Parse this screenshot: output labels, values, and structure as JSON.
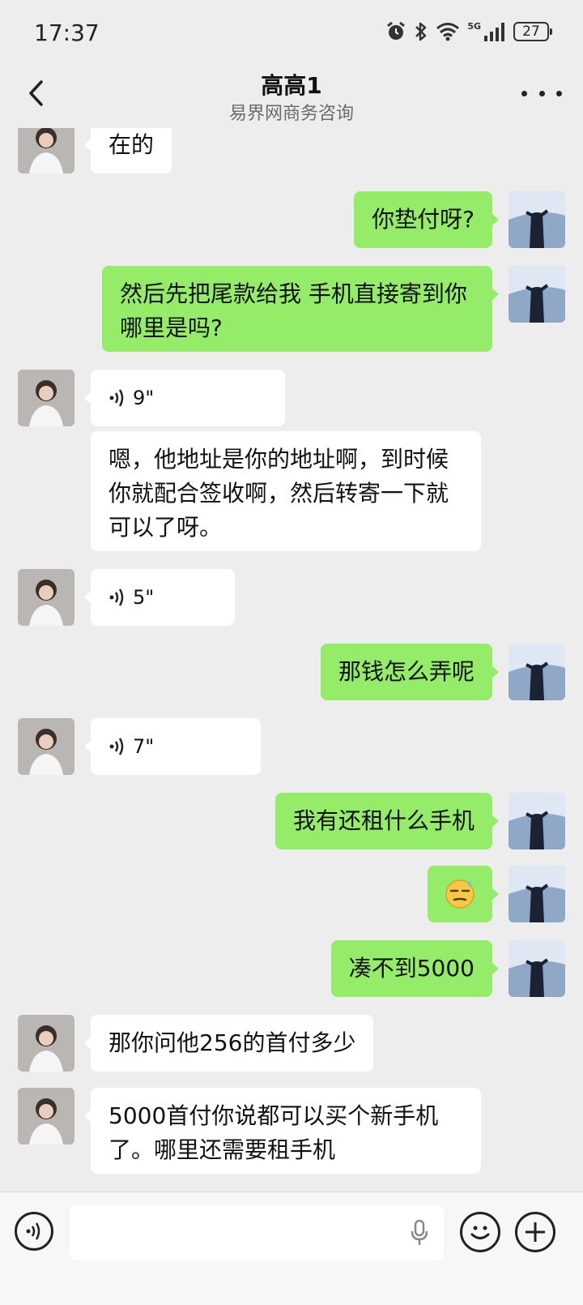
{
  "status_bar": {
    "time": "17:37",
    "network": "5G",
    "battery": "27",
    "icons": [
      "alarm-icon",
      "bluetooth-icon",
      "wifi-icon",
      "signal-icon",
      "battery-icon"
    ]
  },
  "header": {
    "title": "高高1",
    "subtitle": "易界网商务咨询",
    "back_icon": "chevron-left-icon",
    "more_icon": "more-dots-icon"
  },
  "messages": [
    {
      "from": "other",
      "type": "text",
      "text": "在的"
    },
    {
      "from": "me",
      "type": "text",
      "text": "你垫付呀?"
    },
    {
      "from": "me",
      "type": "text",
      "text": "然后先把尾款给我 手机直接寄到你哪里是吗?"
    },
    {
      "from": "other",
      "type": "voice",
      "duration": "9\""
    },
    {
      "from": "other",
      "type": "text",
      "text": "嗯，他地址是你的地址啊，到时候你就配合签收啊，然后转寄一下就可以了呀。"
    },
    {
      "from": "other",
      "type": "voice",
      "duration": "5\""
    },
    {
      "from": "me",
      "type": "text",
      "text": "那钱怎么弄呢"
    },
    {
      "from": "other",
      "type": "voice",
      "duration": "7\""
    },
    {
      "from": "me",
      "type": "text",
      "text": "我有还租什么手机"
    },
    {
      "from": "me",
      "type": "emoji",
      "icon": "sweat-emoji-icon"
    },
    {
      "from": "me",
      "type": "text",
      "text": "凑不到5000"
    },
    {
      "from": "other",
      "type": "text",
      "text": "那你问他256的首付多少"
    },
    {
      "from": "other",
      "type": "text",
      "text": "5000首付你说都可以买个新手机了。哪里还需要租手机"
    }
  ],
  "input_bar": {
    "voice_icon": "voice-mode-icon",
    "mic_icon": "microphone-icon",
    "emoji_icon": "emoji-icon",
    "plus_icon": "plus-icon",
    "placeholder": ""
  },
  "colors": {
    "background": "#ededed",
    "outgoing_bubble": "#95ec69",
    "incoming_bubble": "#ffffff"
  }
}
